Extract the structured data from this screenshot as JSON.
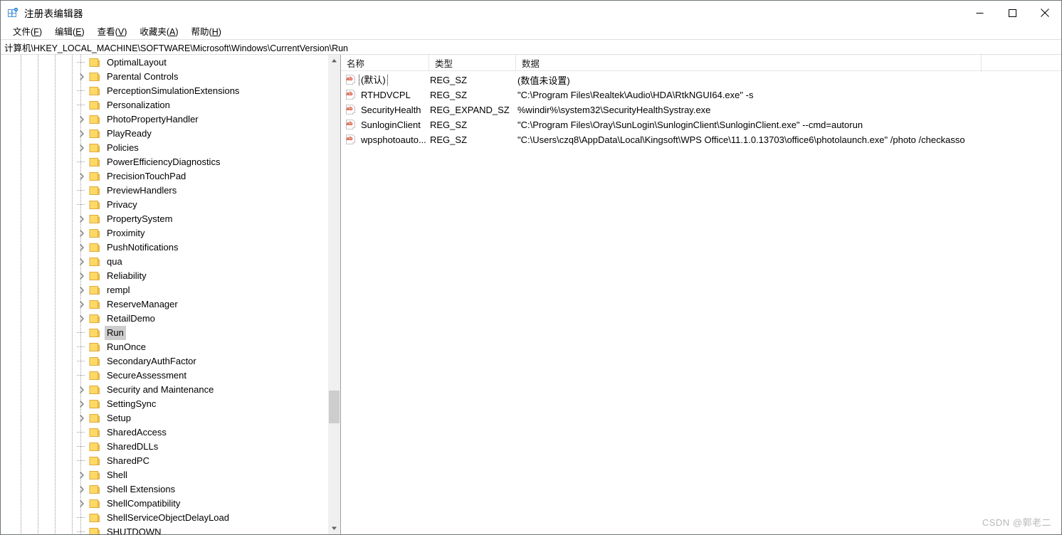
{
  "window": {
    "title": "注册表编辑器",
    "icon": "registry-editor-icon",
    "minimize_label": "—",
    "maximize_label": "□",
    "close_label": "✕"
  },
  "menubar": {
    "items": [
      {
        "label": "文件(F)",
        "text": "文件(",
        "accel": "F",
        "tail": ")"
      },
      {
        "label": "编辑(E)",
        "text": "编辑(",
        "accel": "E",
        "tail": ")"
      },
      {
        "label": "查看(V)",
        "text": "查看(",
        "accel": "V",
        "tail": ")"
      },
      {
        "label": "收藏夹(A)",
        "text": "收藏夹(",
        "accel": "A",
        "tail": ")"
      },
      {
        "label": "帮助(H)",
        "text": "帮助(",
        "accel": "H",
        "tail": ")"
      }
    ]
  },
  "address": {
    "path": "计算机\\HKEY_LOCAL_MACHINE\\SOFTWARE\\Microsoft\\Windows\\CurrentVersion\\Run"
  },
  "tree": {
    "nodes": [
      {
        "label": "OptimalLayout",
        "expandable": false,
        "selected": false
      },
      {
        "label": "Parental Controls",
        "expandable": true,
        "selected": false
      },
      {
        "label": "PerceptionSimulationExtensions",
        "expandable": false,
        "selected": false
      },
      {
        "label": "Personalization",
        "expandable": false,
        "selected": false
      },
      {
        "label": "PhotoPropertyHandler",
        "expandable": true,
        "selected": false
      },
      {
        "label": "PlayReady",
        "expandable": true,
        "selected": false
      },
      {
        "label": "Policies",
        "expandable": true,
        "selected": false
      },
      {
        "label": "PowerEfficiencyDiagnostics",
        "expandable": false,
        "selected": false
      },
      {
        "label": "PrecisionTouchPad",
        "expandable": true,
        "selected": false
      },
      {
        "label": "PreviewHandlers",
        "expandable": false,
        "selected": false
      },
      {
        "label": "Privacy",
        "expandable": false,
        "selected": false
      },
      {
        "label": "PropertySystem",
        "expandable": true,
        "selected": false
      },
      {
        "label": "Proximity",
        "expandable": true,
        "selected": false
      },
      {
        "label": "PushNotifications",
        "expandable": true,
        "selected": false
      },
      {
        "label": "qua",
        "expandable": true,
        "selected": false
      },
      {
        "label": "Reliability",
        "expandable": true,
        "selected": false
      },
      {
        "label": "rempl",
        "expandable": true,
        "selected": false
      },
      {
        "label": "ReserveManager",
        "expandable": true,
        "selected": false
      },
      {
        "label": "RetailDemo",
        "expandable": true,
        "selected": false
      },
      {
        "label": "Run",
        "expandable": false,
        "selected": true
      },
      {
        "label": "RunOnce",
        "expandable": false,
        "selected": false
      },
      {
        "label": "SecondaryAuthFactor",
        "expandable": false,
        "selected": false
      },
      {
        "label": "SecureAssessment",
        "expandable": false,
        "selected": false
      },
      {
        "label": "Security and Maintenance",
        "expandable": true,
        "selected": false
      },
      {
        "label": "SettingSync",
        "expandable": true,
        "selected": false
      },
      {
        "label": "Setup",
        "expandable": true,
        "selected": false
      },
      {
        "label": "SharedAccess",
        "expandable": false,
        "selected": false
      },
      {
        "label": "SharedDLLs",
        "expandable": false,
        "selected": false
      },
      {
        "label": "SharedPC",
        "expandable": false,
        "selected": false
      },
      {
        "label": "Shell",
        "expandable": true,
        "selected": false
      },
      {
        "label": "Shell Extensions",
        "expandable": true,
        "selected": false
      },
      {
        "label": "ShellCompatibility",
        "expandable": true,
        "selected": false
      },
      {
        "label": "ShellServiceObjectDelayLoad",
        "expandable": false,
        "selected": false
      },
      {
        "label": "SHUTDOWN",
        "expandable": false,
        "selected": false
      }
    ],
    "scrollbar": {
      "up_arrow": "scroll-up-arrow",
      "down_arrow": "scroll-down-arrow"
    }
  },
  "value_list": {
    "columns": {
      "name": "名称",
      "type": "类型",
      "data": "数据"
    },
    "rows": [
      {
        "name": "(默认)",
        "type": "REG_SZ",
        "data": "(数值未设置)",
        "focused": true
      },
      {
        "name": "RTHDVCPL",
        "type": "REG_SZ",
        "data": "\"C:\\Program Files\\Realtek\\Audio\\HDA\\RtkNGUI64.exe\" -s",
        "focused": false
      },
      {
        "name": "SecurityHealth",
        "type": "REG_EXPAND_SZ",
        "data": "%windir%\\system32\\SecurityHealthSystray.exe",
        "focused": false
      },
      {
        "name": "SunloginClient",
        "type": "REG_SZ",
        "data": "\"C:\\Program Files\\Oray\\SunLogin\\SunloginClient\\SunloginClient.exe\" --cmd=autorun",
        "focused": false
      },
      {
        "name": "wpsphotoauto...",
        "type": "REG_SZ",
        "data": "\"C:\\Users\\czq8\\AppData\\Local\\Kingsoft\\WPS Office\\11.1.0.13703\\office6\\photolaunch.exe\" /photo /checkasso",
        "focused": false
      }
    ]
  },
  "watermark": {
    "text": "CSDN @郭老二"
  },
  "colors": {
    "folder": "#ffd966",
    "folder_edge": "#e8b10a",
    "selection": "#cdcdcd",
    "ab_red": "#cc0000",
    "accent_blue": "#2b86d6",
    "watermark": "#b8b8b8"
  }
}
